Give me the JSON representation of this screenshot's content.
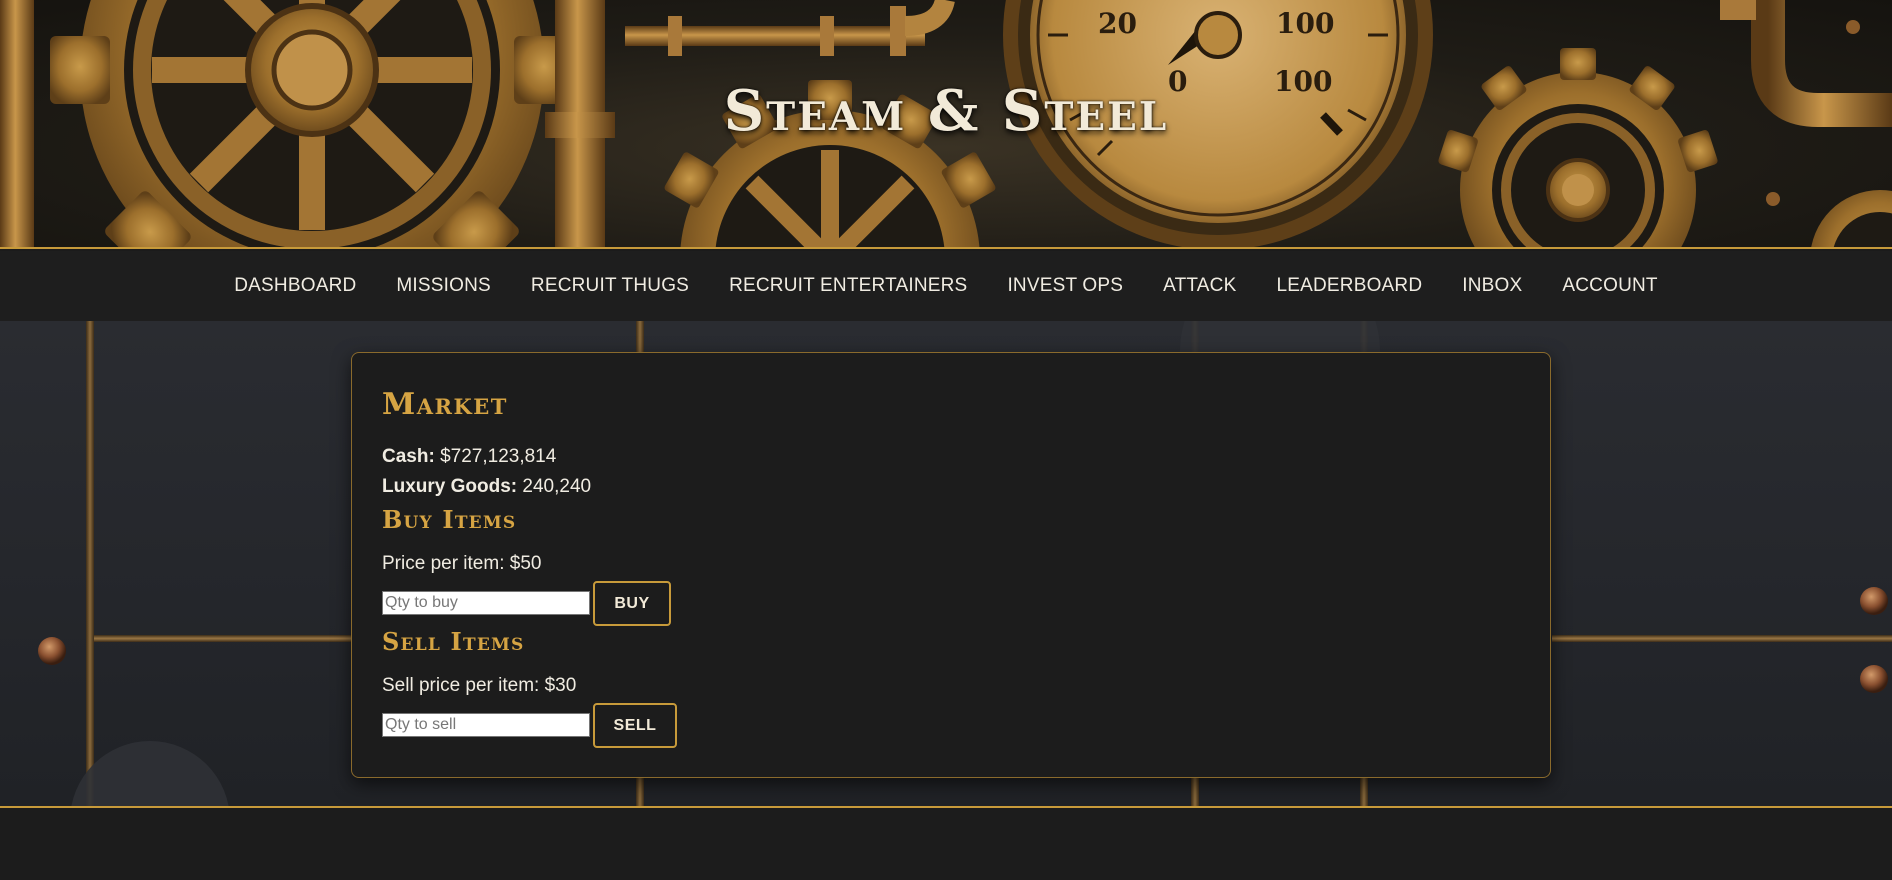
{
  "site": {
    "title": "Steam & Steel"
  },
  "nav": {
    "items": [
      {
        "label": "DASHBOARD"
      },
      {
        "label": "MISSIONS"
      },
      {
        "label": "RECRUIT THUGS"
      },
      {
        "label": "RECRUIT ENTERTAINERS"
      },
      {
        "label": "INVEST OPS"
      },
      {
        "label": "ATTACK"
      },
      {
        "label": "LEADERBOARD"
      },
      {
        "label": "INBOX"
      },
      {
        "label": "ACCOUNT"
      }
    ]
  },
  "market": {
    "title": "Market",
    "cash_label": "Cash:",
    "cash_value": "$727,123,814",
    "goods_label": "Luxury Goods:",
    "goods_value": "240,240",
    "buy": {
      "title": "Buy Items",
      "price_text": "Price per item: $50",
      "placeholder": "Qty to buy",
      "value": "",
      "button_label": "BUY"
    },
    "sell": {
      "title": "Sell Items",
      "price_text": "Sell price per item: $30",
      "placeholder": "Qty to sell",
      "value": "",
      "button_label": "SELL"
    }
  },
  "colors": {
    "accent_gold": "#d6a443",
    "border_gold": "#c79a3a",
    "card_bg": "#1c1c1c",
    "nav_bg": "#1e1e1e",
    "text": "#f0ece2"
  },
  "icons": {
    "banner_art": [
      "gear-icon",
      "pressure-gauge-icon",
      "pipe-icon",
      "rivet-icon"
    ]
  }
}
